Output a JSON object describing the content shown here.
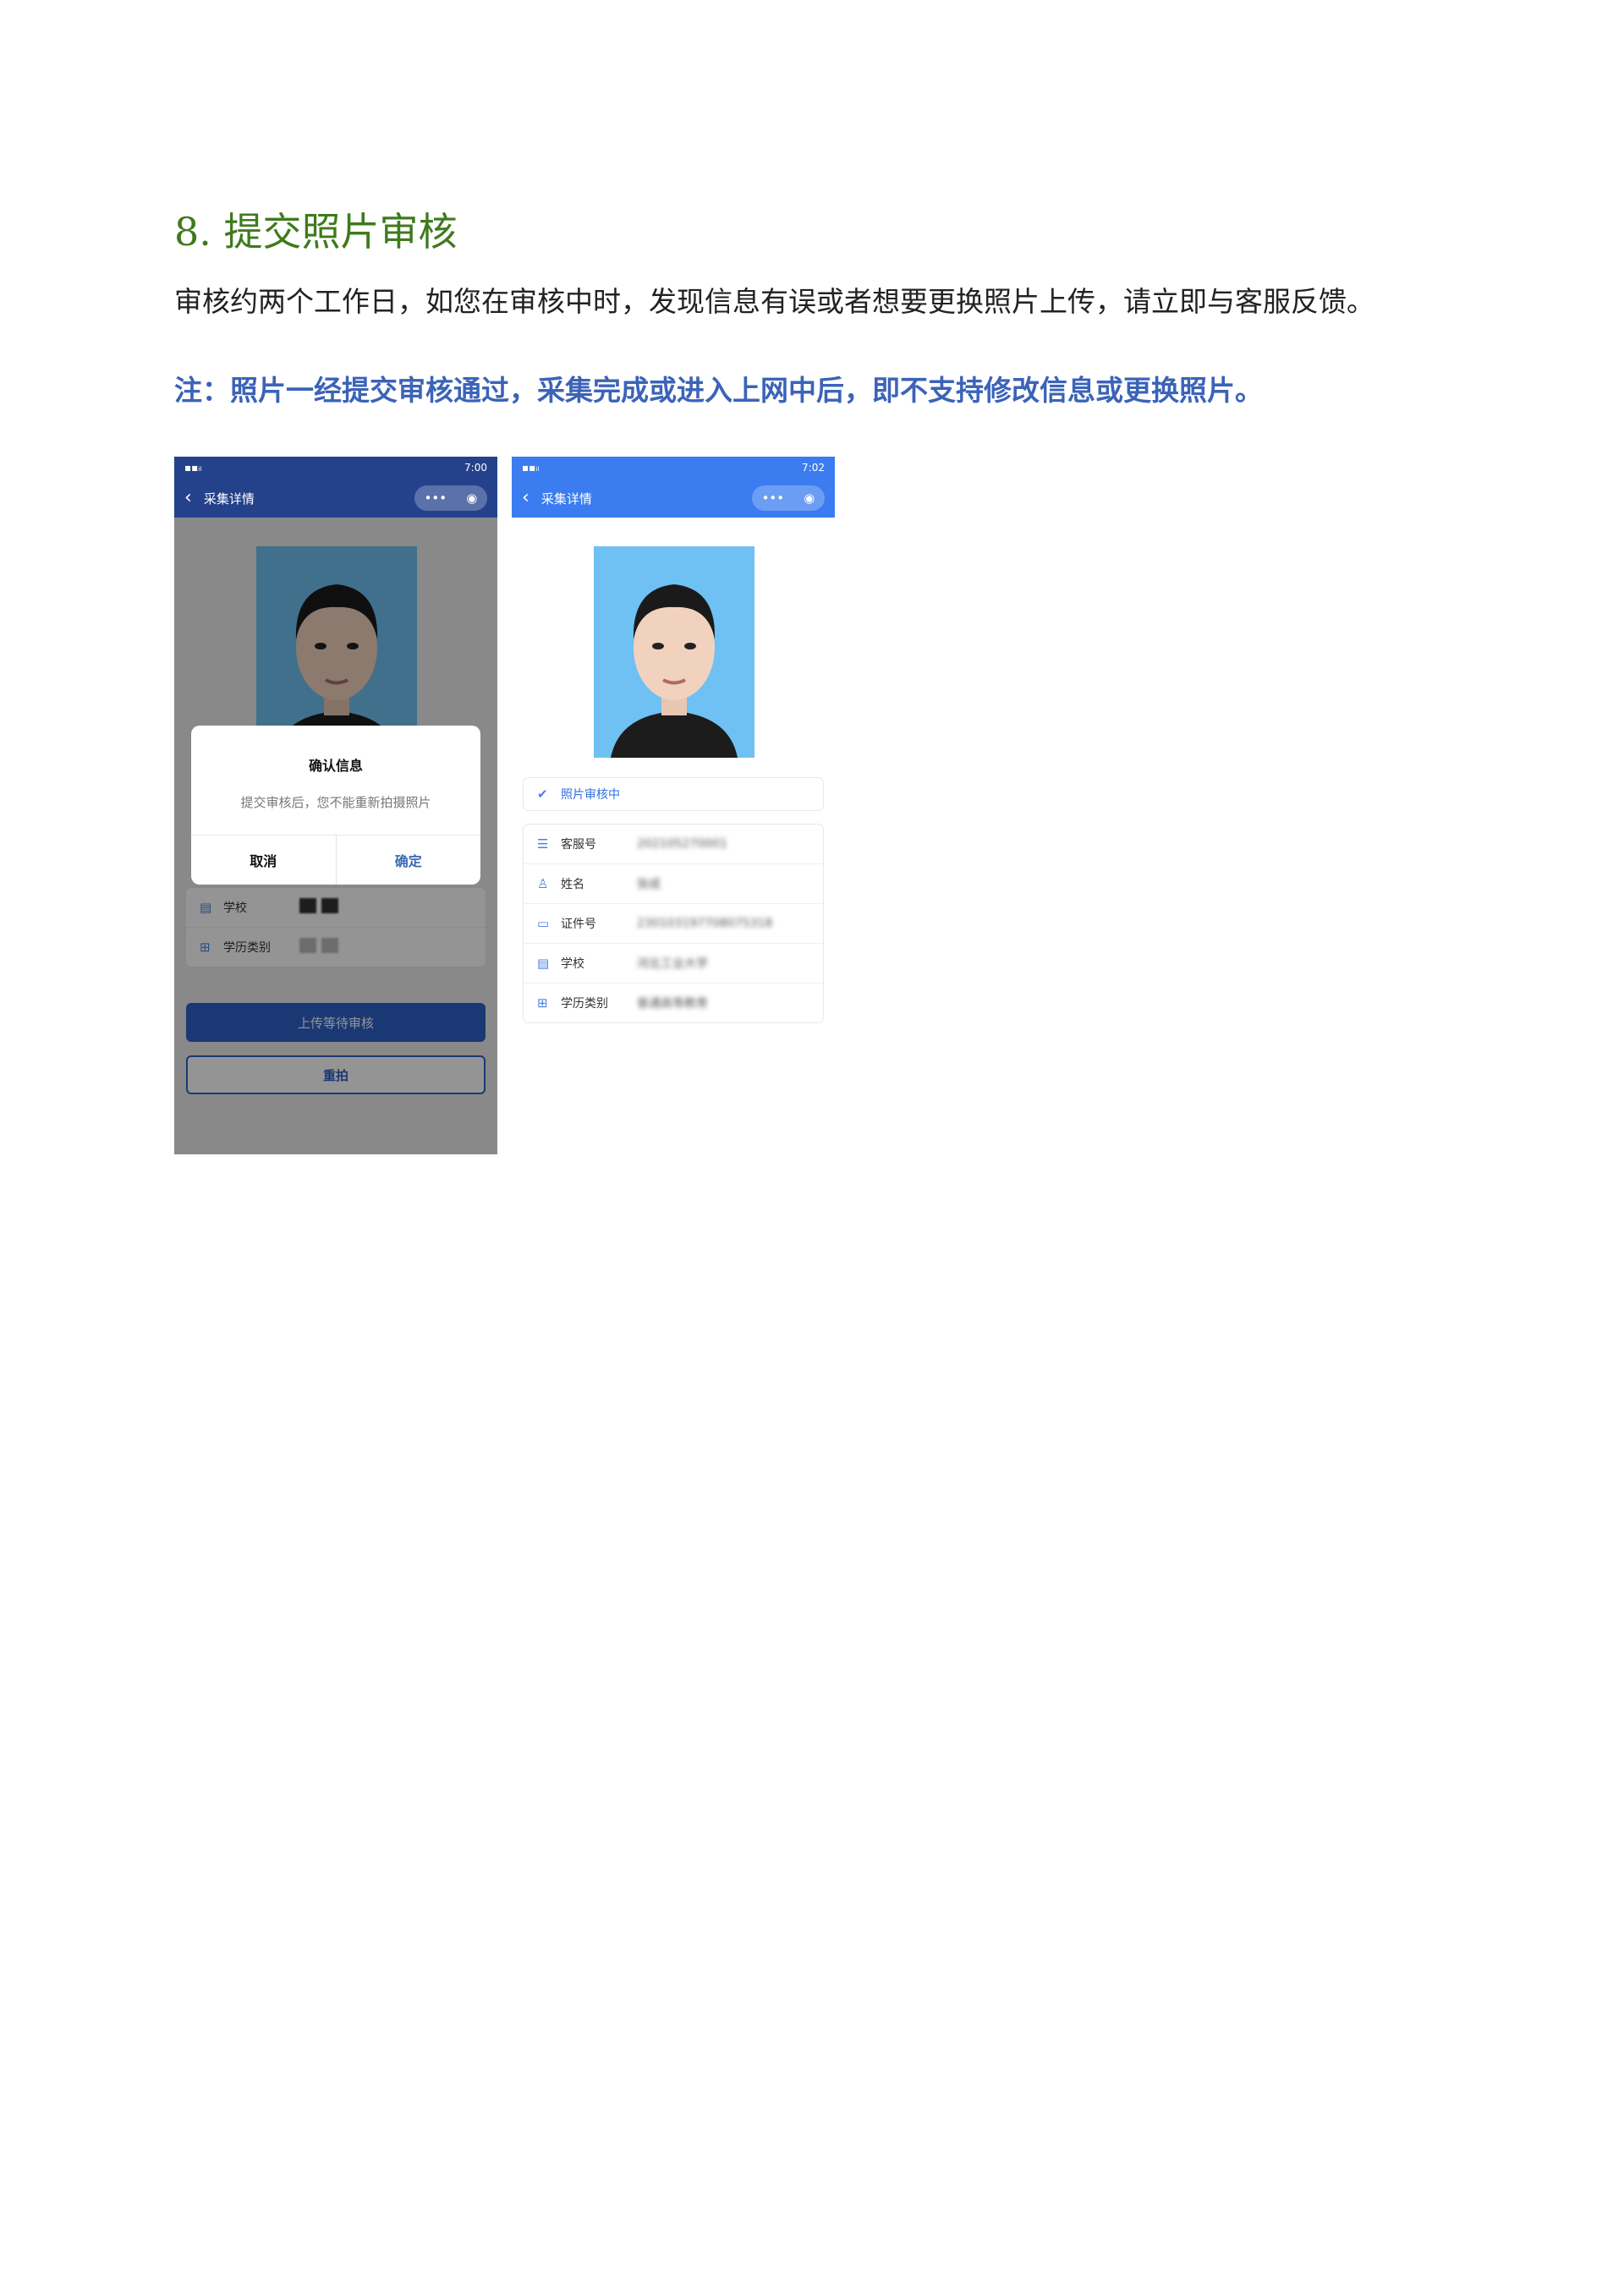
{
  "heading": "8. 提交照片审核",
  "paragraph": "审核约两个工作日，如您在审核中时，发现信息有误或者想要更换照片上传，请立即与客服反馈。",
  "note": "注：照片一经提交审核通过，采集完成或进入上网中后，即不支持修改信息或更换照片。",
  "screen1": {
    "time": "7:00",
    "nav_title": "采集详情",
    "dialog": {
      "title": "确认信息",
      "message": "提交审核后，您不能重新拍摄照片",
      "cancel": "取消",
      "confirm": "确定"
    },
    "fields": [
      {
        "icon": "building-icon",
        "label": "学校"
      },
      {
        "icon": "grid-icon",
        "label": "学历类别"
      }
    ],
    "primary_button": "上传等待审核",
    "secondary_button": "重拍"
  },
  "screen2": {
    "time": "7:02",
    "nav_title": "采集详情",
    "status": "照片审核中",
    "fields": [
      {
        "icon": "list-icon",
        "label": "客服号",
        "value": "202105270001"
      },
      {
        "icon": "person-icon",
        "label": "姓名",
        "value": "张成"
      },
      {
        "icon": "id-card-icon",
        "label": "证件号",
        "value": "230103197708075318"
      },
      {
        "icon": "building-icon",
        "label": "学校",
        "value": "河北工业大学"
      },
      {
        "icon": "grid-icon",
        "label": "学历类别",
        "value": "普通高等教育"
      }
    ]
  },
  "colors": {
    "heading": "#3f7a1c",
    "note": "#3b63b8",
    "navbar_dim": "#24428c",
    "navbar": "#3b7cf0",
    "photo_bg": "#6ec1f2"
  }
}
